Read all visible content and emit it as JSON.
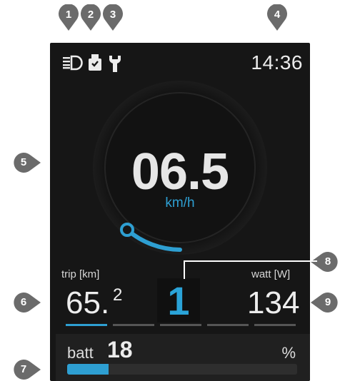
{
  "callouts": [
    "1",
    "2",
    "3",
    "4",
    "5",
    "6",
    "7",
    "8",
    "9"
  ],
  "status": {
    "clock": "14:36",
    "icons": [
      "headlight-icon",
      "usb-icon",
      "wrench-icon"
    ]
  },
  "speed": {
    "value": "06.5",
    "unit": "km/h"
  },
  "trip": {
    "label": "trip [km]",
    "value_int": "65.",
    "value_frac": "2"
  },
  "assist": {
    "level": "1"
  },
  "power": {
    "label": "watt [W]",
    "value": "134"
  },
  "battery": {
    "label": "batt",
    "value": "18",
    "unit": "%",
    "level": 0.18
  },
  "colors": {
    "accent": "#2e9fd2",
    "screen": "#161616",
    "callout": "#6b6b6b"
  }
}
